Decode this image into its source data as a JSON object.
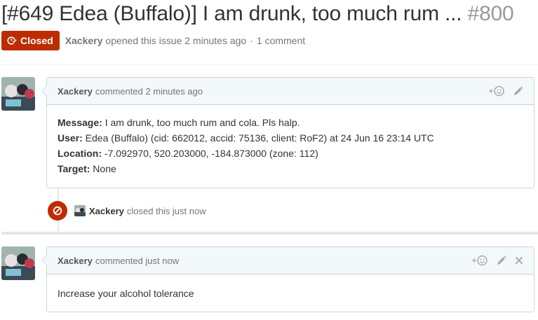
{
  "issue": {
    "title": "[#649 Edea (Buffalo)] I am drunk, too much rum ...",
    "number": "#800",
    "state": "Closed",
    "author": "Xackery",
    "opened_text": "opened this issue 2 minutes ago",
    "separator": "·",
    "comment_count": "1 comment"
  },
  "comments": [
    {
      "author": "Xackery",
      "time_text": "commented 2 minutes ago",
      "fields": [
        {
          "label": "Message:",
          "value": " I am drunk, too much rum and cola. Pls halp."
        },
        {
          "label": "User:",
          "value": " Edea (Buffalo) (cid: 662012, accid: 75136, client: RoF2) at 24 Jun 16 23:14 UTC"
        },
        {
          "label": "Location:",
          "value": " -7.092970, 520.203000, -184.873000 (zone: 112)"
        },
        {
          "label": "Target:",
          "value": " None"
        }
      ]
    },
    {
      "author": "Xackery",
      "time_text": "commented just now",
      "body": "Increase your alcohol tolerance"
    }
  ],
  "event": {
    "actor": "Xackery",
    "text": "closed this just now"
  },
  "icons": {
    "state": "issue-closed-icon",
    "reaction": "smiley-icon",
    "edit": "pencil-icon",
    "delete": "close-icon",
    "event": "circle-slash-icon"
  },
  "colors": {
    "closed": "#bd2c00",
    "comment_header_bg": "#f3f8fb",
    "comment_border": "#d1d5da"
  }
}
